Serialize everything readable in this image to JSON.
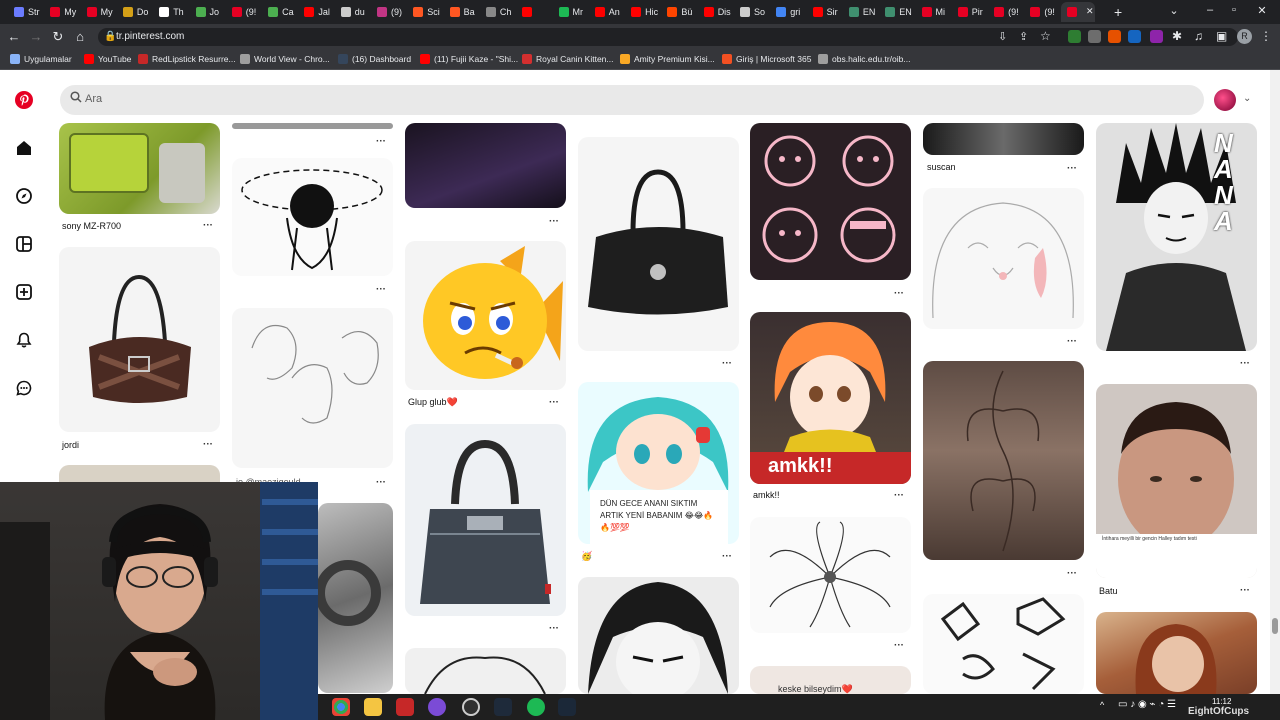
{
  "browser": {
    "url": "tr.pinterest.com",
    "tabs": [
      {
        "label": "Str",
        "color": "#6b7cff"
      },
      {
        "label": "My",
        "color": "#e60023"
      },
      {
        "label": "My",
        "color": "#e60023"
      },
      {
        "label": "Do",
        "color": "#d4a017"
      },
      {
        "label": "Th",
        "color": "#ffffff"
      },
      {
        "label": "Jo",
        "color": "#4caf50"
      },
      {
        "label": "(9!",
        "color": "#e60023"
      },
      {
        "label": "Ca",
        "color": "#4caf50"
      },
      {
        "label": "Jal",
        "color": "#ff0000"
      },
      {
        "label": "du",
        "color": "#cccccc"
      },
      {
        "label": "(9)",
        "color": "#c13584"
      },
      {
        "label": "Sci",
        "color": "#ff5722"
      },
      {
        "label": "Ba",
        "color": "#ff5722"
      },
      {
        "label": "Ch",
        "color": "#888888"
      },
      {
        "label": "",
        "color": "#ff0000"
      },
      {
        "label": "Mr",
        "color": "#1db954"
      },
      {
        "label": "An",
        "color": "#ff0000"
      },
      {
        "label": "Hic",
        "color": "#ff0000"
      },
      {
        "label": "Bü",
        "color": "#ff4500"
      },
      {
        "label": "Dis",
        "color": "#ff0000"
      },
      {
        "label": "So",
        "color": "#cccccc"
      },
      {
        "label": "gri",
        "color": "#4285f4"
      },
      {
        "label": "Sir",
        "color": "#ff0000"
      },
      {
        "label": "EN",
        "color": "#3f8f6f"
      },
      {
        "label": "EN",
        "color": "#3f8f6f"
      },
      {
        "label": "Mi",
        "color": "#e60023"
      },
      {
        "label": "Pir",
        "color": "#e60023"
      },
      {
        "label": "(9!",
        "color": "#e60023"
      },
      {
        "label": "(9!",
        "color": "#e60023"
      },
      {
        "label": "",
        "color": "#e60023"
      }
    ],
    "new_tab_glyph": "+",
    "bookmarks": [
      {
        "label": "Uygulamalar",
        "color": "#8ab4f8"
      },
      {
        "label": "YouTube",
        "color": "#ff0000"
      },
      {
        "label": "RedLipstick Resurre...",
        "color": "#c62828"
      },
      {
        "label": "World View - Chro...",
        "color": "#9e9e9e"
      },
      {
        "label": "(16) Dashboard",
        "color": "#35465c"
      },
      {
        "label": "(11) Fujii Kaze - \"Shi...",
        "color": "#ff0000"
      },
      {
        "label": "Royal Canin Kitten...",
        "color": "#d32f2f"
      },
      {
        "label": "Amity Premium Kisi...",
        "color": "#f9a825"
      },
      {
        "label": "Giriş | Microsoft 365",
        "color": "#f25022"
      },
      {
        "label": "obs.halic.edu.tr/oib...",
        "color": "#9e9e9e"
      }
    ]
  },
  "search": {
    "placeholder": "Ara"
  },
  "pins": {
    "col1": [
      {
        "label": "sony MZ-R700"
      },
      {
        "label": "jordi"
      }
    ],
    "col2": [
      {
        "label": "jo @maezigould"
      }
    ],
    "col3": [
      {
        "label": "Glup glub❤️"
      }
    ],
    "col4": [
      {
        "label": "🥳"
      },
      {
        "caption": "DÜN GECE ANANI SIKTIM\nARTIK YENİ BABANIM 😂😂🔥\n🔥💯💯"
      }
    ],
    "col5": [
      {
        "label": "amkk!!"
      },
      {
        "caption": "amkk!!"
      },
      {
        "caption": "keske bilseydim❤️"
      }
    ],
    "col6": [
      {
        "label": "suscan"
      }
    ],
    "col7": [
      {
        "label": "Batu"
      },
      {
        "caption": "İntihara meyilli bir gencin Halley tadım testi"
      },
      {
        "sidebar_text": "NANA"
      }
    ]
  },
  "taskbar": {
    "time": "11:12"
  },
  "watermark": "EightOfCups"
}
